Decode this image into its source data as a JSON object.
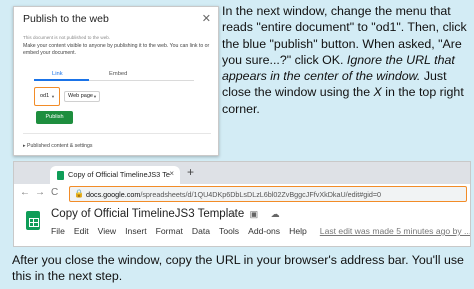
{
  "dialog": {
    "title": "Publish to the web",
    "close_glyph": "✕",
    "note": "This document is not published to the web.",
    "description": "Make your content visible to anyone by publishing it to the web. You can link to or embed your document.",
    "tabs": [
      "Link",
      "Embed"
    ],
    "doc_select": "od1",
    "format_select": "Web page",
    "publish_label": "Publish",
    "footer": "▸ Published content & settings"
  },
  "instructions": {
    "p1": "In the next window, change the menu that reads \"entire document\" to \"od1\". Then, click the blue \"publish\" button. When asked, \"Are you sure...?\" click OK. ",
    "p1_italic": "Ignore the URL that appears in the center of the window.",
    "p1_tail": " Just close the window using the ",
    "p1_x": "X",
    "p1_end": " in the top right corner."
  },
  "browser": {
    "tab_title": "Copy of Official TimelineJS3 Te",
    "tab_close": "×",
    "new_tab": "+",
    "nav": {
      "back": "←",
      "forward": "→",
      "reload": "C"
    },
    "url_host": "docs.google.com",
    "url_path": "/spreadsheets/d/1QU4DKp6DbLsDLzL6bl02ZvBggcJFfvXkDkaU/edit#gid=0",
    "doc_title": "Copy of Official TimelineJS3 Template",
    "doc_icons": "☆ ▣ ☁",
    "menu": [
      "File",
      "Edit",
      "View",
      "Insert",
      "Format",
      "Data",
      "Tools",
      "Add-ons",
      "Help"
    ],
    "last_edit": "Last edit was made 5 minutes ago by ..."
  },
  "bottom_text": "After you close the window, copy the URL in your browser's address bar. You'll use this in the next step."
}
